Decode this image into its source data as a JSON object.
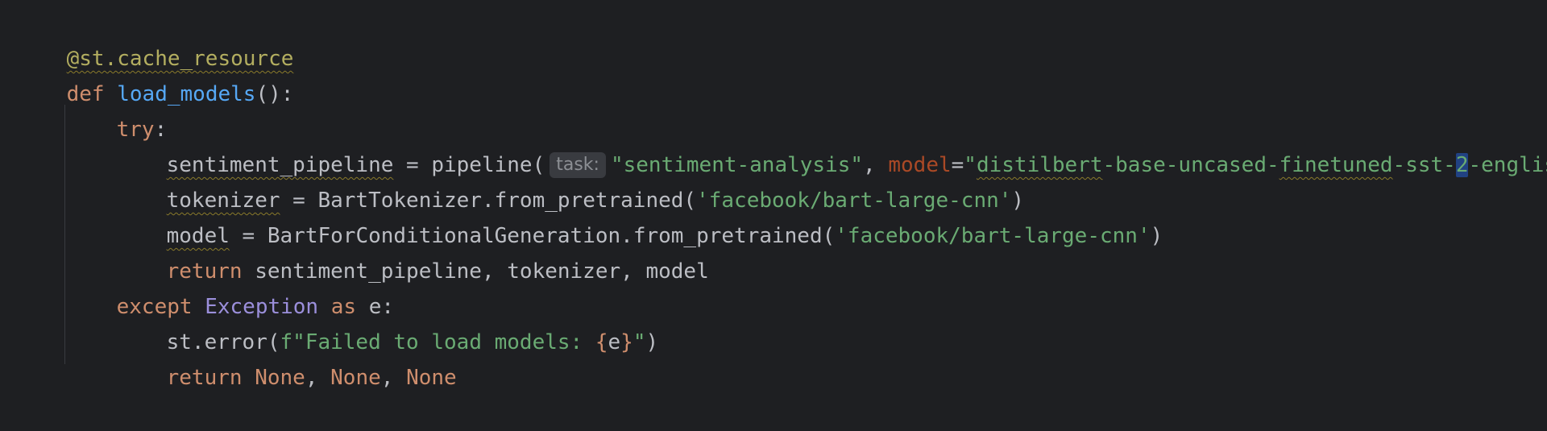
{
  "code": {
    "line1": {
      "decorator": "@st.cache_resource"
    },
    "line2": {
      "kw_def": "def",
      "fn_name": "load_models",
      "parens": "():"
    },
    "line3": {
      "kw_try": "try",
      "colon": ":"
    },
    "line4": {
      "var": "sentiment_pipeline",
      "eq": " = pipeline(",
      "hint": "task:",
      "task_str": "\"sentiment-analysis\"",
      "comma": ", ",
      "param": "model",
      "eq2": "=",
      "model_str_open": "\"",
      "model_str_a": "distilbert",
      "model_str_b": "-base-uncased-",
      "model_str_c": "finetuned",
      "model_str_d": "-sst-",
      "model_str_e": "2",
      "model_str_f": "-english\"",
      "close": ")"
    },
    "line5": {
      "var": "tokenizer",
      "rest": " = BartTokenizer.from_pretrained(",
      "str": "'facebook/bart-large-cnn'",
      "close": ")"
    },
    "line6": {
      "var": "model",
      "rest": " = BartForConditionalGeneration.from_pretrained(",
      "str": "'facebook/bart-large-cnn'",
      "close": ")"
    },
    "line7": {
      "kw_return": "return",
      "rest": " sentiment_pipeline, tokenizer, model"
    },
    "line8": {
      "kw_except": "except",
      "cls": "Exception",
      "kw_as": "as",
      "rest": " e:"
    },
    "line9": {
      "call": "st.error(",
      "fstr_a": "f\"Failed to load models: ",
      "brace_open": "{",
      "var": "e",
      "brace_close": "}",
      "fstr_b": "\"",
      "close": ")"
    },
    "line10": {
      "kw_return": "return",
      "none1": "None",
      "none2": "None",
      "none3": "None",
      "comma": ", "
    }
  }
}
